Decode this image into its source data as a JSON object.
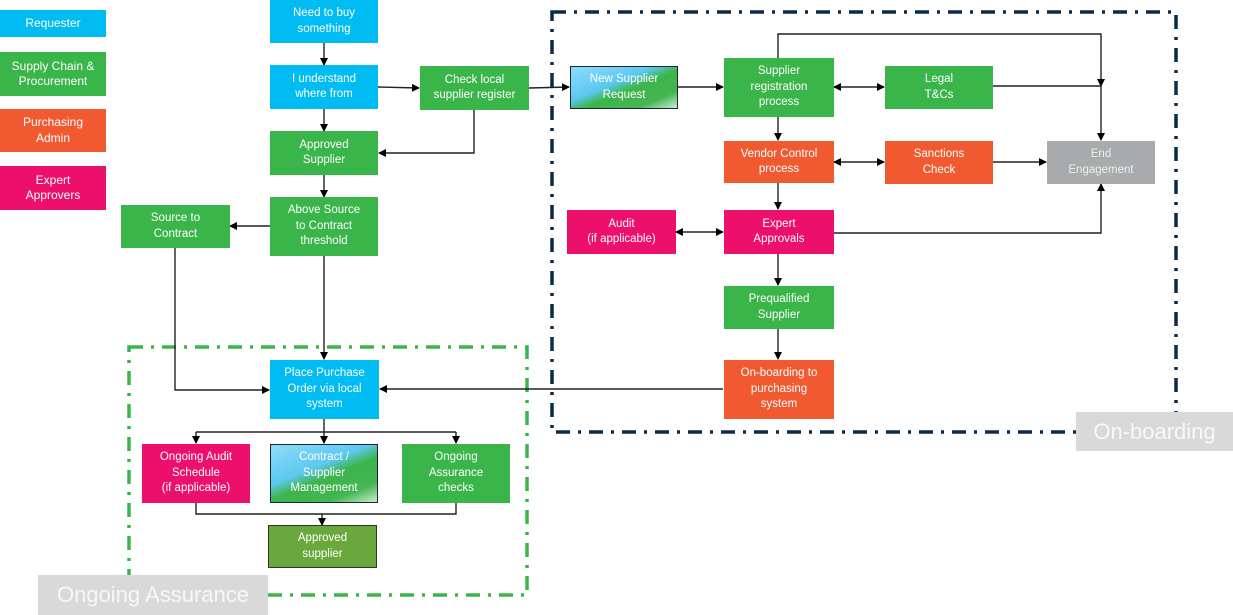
{
  "legend": {
    "items": [
      {
        "label": "Requester",
        "color": "#00bcf2"
      },
      {
        "label": "Supply Chain &\nProcurement",
        "color": "#39b54a"
      },
      {
        "label": "Purchasing\nAdmin",
        "color": "#f15a31"
      },
      {
        "label": "Expert\nApprovers",
        "color": "#ec0f6b"
      }
    ]
  },
  "regions": {
    "onboarding": {
      "label": "On-boarding",
      "border_color": "#0b2a47"
    },
    "ongoing": {
      "label": "Ongoing Assurance",
      "border_color": "#39b54a"
    }
  },
  "nodes": {
    "need_to_buy": "Need to buy\nsomething",
    "understand": "I understand\nwhere from",
    "check_local": "Check local\nsupplier register",
    "approved_supplier": "Approved\nSupplier",
    "above_threshold": "Above Source\nto  Contract\nthreshold",
    "source_to_contract": "Source to\nContract",
    "new_supplier": "New Supplier\nRequest",
    "supplier_registration": "Supplier\nregistration\nprocess",
    "legal": "Legal\nT&Cs",
    "vendor_control": "Vendor Control\nprocess",
    "sanctions": "Sanctions\nCheck",
    "end_engagement": "End\nEngagement",
    "audit": "Audit\n(if applicable)",
    "expert_approvals": "Expert\nApprovals",
    "prequalified": "Prequalified\nSupplier",
    "onboarding_purchasing": "On-boarding to\npurchasing\nsystem",
    "place_po": "Place Purchase\nOrder  via local\nsystem",
    "ongoing_audit": "Ongoing Audit\nSchedule\n(if applicable)",
    "contract_mgmt": "Contract /\nSupplier\nManagement",
    "ongoing_checks": "Ongoing\nAssurance\nchecks",
    "approved_supplier_final": "Approved\nsupplier"
  }
}
